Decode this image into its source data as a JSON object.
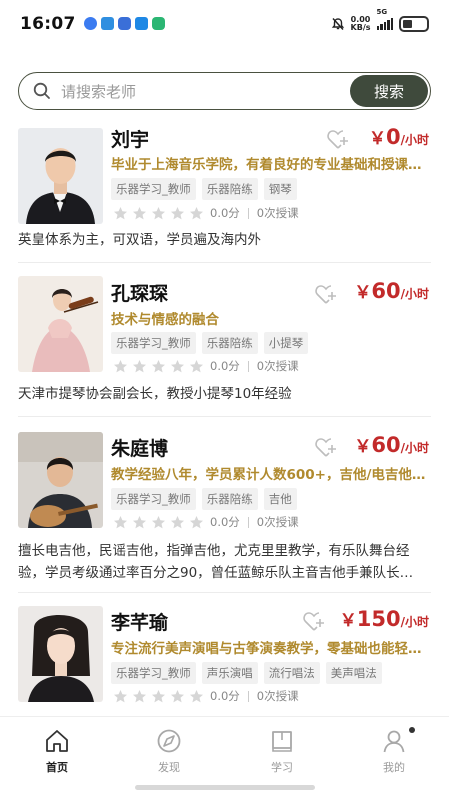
{
  "status_bar": {
    "time": "16:07",
    "speed_value": "0.00",
    "speed_unit": "KB/s",
    "network": "5G",
    "battery_level": 0.25
  },
  "search": {
    "placeholder": "请搜索老师",
    "button_label": "搜索"
  },
  "teachers": [
    {
      "name": "刘宇",
      "price_currency": "￥",
      "price_value": "0",
      "price_unit": "/小时",
      "description": "毕业于上海音乐学院，有着良好的专业基础和授课…",
      "tags": [
        "乐器学习_教师",
        "乐器陪练",
        "钢琴"
      ],
      "rating_stars": 0,
      "score": "0.0分",
      "lessons": "0次授课",
      "bio": "英皇体系为主，可双语，学员遍及海内外",
      "avatar_icon": "teacher-photo-man-in-tuxedo"
    },
    {
      "name": "孔琛琛",
      "price_currency": "￥",
      "price_value": "60",
      "price_unit": "/小时",
      "description": "技术与情感的融合",
      "tags": [
        "乐器学习_教师",
        "乐器陪练",
        "小提琴"
      ],
      "rating_stars": 0,
      "score": "0.0分",
      "lessons": "0次授课",
      "bio": "天津市提琴协会副会长，教授小提琴10年经验",
      "avatar_icon": "teacher-photo-violinist-pink-dress"
    },
    {
      "name": "朱庭博",
      "price_currency": "￥",
      "price_value": "60",
      "price_unit": "/小时",
      "description": "教学经验八年，学员累计人数600+，吉他/电吉他/…",
      "tags": [
        "乐器学习_教师",
        "乐器陪练",
        "吉他"
      ],
      "rating_stars": 0,
      "score": "0.0分",
      "lessons": "0次授课",
      "bio": "擅长电吉他，民谣吉他，指弹吉他，尤克里里教学，有乐队舞台经验，学员考级通过率百分之90，曾任蓝鲸乐队主音吉他手兼队长…",
      "avatar_icon": "teacher-photo-guitarist"
    },
    {
      "name": "李芊瑜",
      "price_currency": "￥",
      "price_value": "150",
      "price_unit": "/小时",
      "description": "专注流行美声演唱与古筝演奏教学，零基础也能轻…",
      "tags": [
        "乐器学习_教师",
        "声乐演唱",
        "流行唱法",
        "美声唱法"
      ],
      "rating_stars": 0,
      "score": "0.0分",
      "lessons": "0次授课",
      "bio": "",
      "avatar_icon": "teacher-photo-woman-portrait"
    }
  ],
  "tabbar": {
    "items": [
      {
        "label": "首页",
        "icon": "home-icon",
        "active": true
      },
      {
        "label": "发现",
        "icon": "discover-icon",
        "active": false
      },
      {
        "label": "学习",
        "icon": "book-icon",
        "active": false
      },
      {
        "label": "我的",
        "icon": "profile-icon",
        "active": false
      }
    ]
  },
  "colors": {
    "accent": "#3f4a3c",
    "price": "#c22a2a",
    "description": "#b08a2e"
  }
}
